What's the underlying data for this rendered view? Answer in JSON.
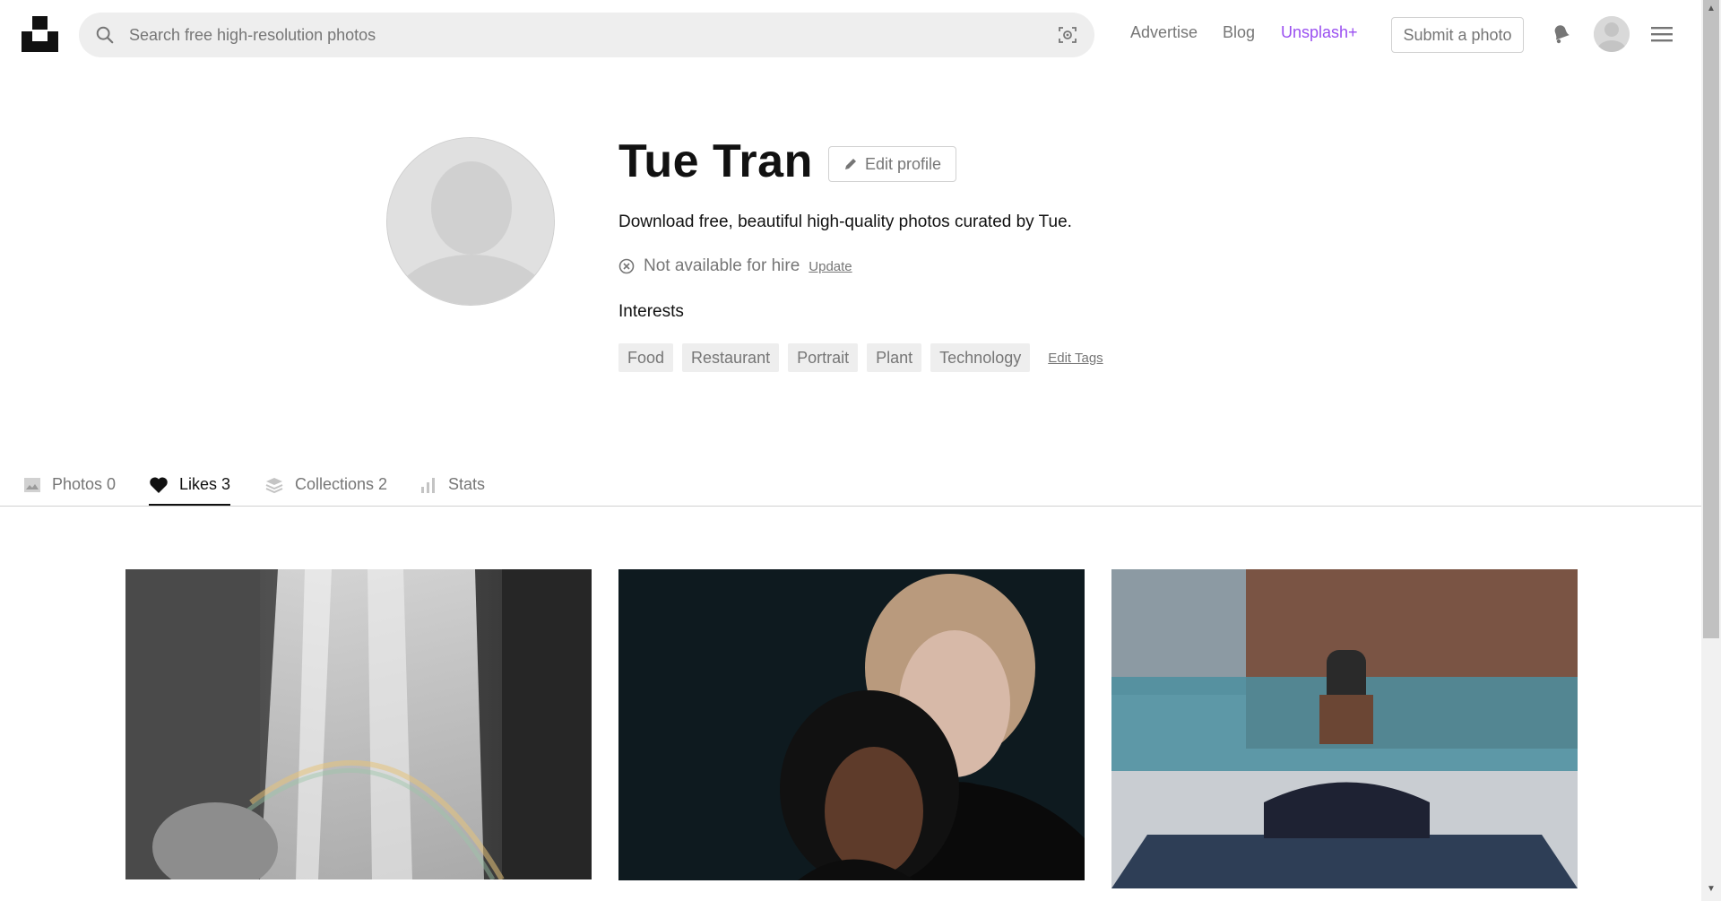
{
  "header": {
    "search_placeholder": "Search free high-resolution photos",
    "nav": {
      "advertise": "Advertise",
      "blog": "Blog",
      "unsplash_plus": "Unsplash+"
    },
    "submit_label": "Submit a photo"
  },
  "profile": {
    "name": "Tue Tran",
    "edit_label": "Edit profile",
    "bio": "Download free, beautiful high-quality photos curated by Tue.",
    "hire_status": "Not available for hire",
    "update_label": "Update",
    "interests_title": "Interests",
    "tags": [
      "Food",
      "Restaurant",
      "Portrait",
      "Plant",
      "Technology"
    ],
    "edit_tags_label": "Edit Tags"
  },
  "tabs": [
    {
      "label": "Photos 0",
      "icon": "image-icon",
      "active": false
    },
    {
      "label": "Likes 3",
      "icon": "heart-icon",
      "active": true
    },
    {
      "label": "Collections 2",
      "icon": "layers-icon",
      "active": false
    },
    {
      "label": "Stats",
      "icon": "bar-chart-icon",
      "active": false
    }
  ],
  "photos": [
    {
      "subject": "waterfall-with-rainbow"
    },
    {
      "subject": "two-women-portrait"
    },
    {
      "subject": "woman-meditating-on-yoga-mat"
    }
  ],
  "colors": {
    "accent_plus": "#9a4ff0",
    "muted": "#767676",
    "text": "#111111"
  }
}
